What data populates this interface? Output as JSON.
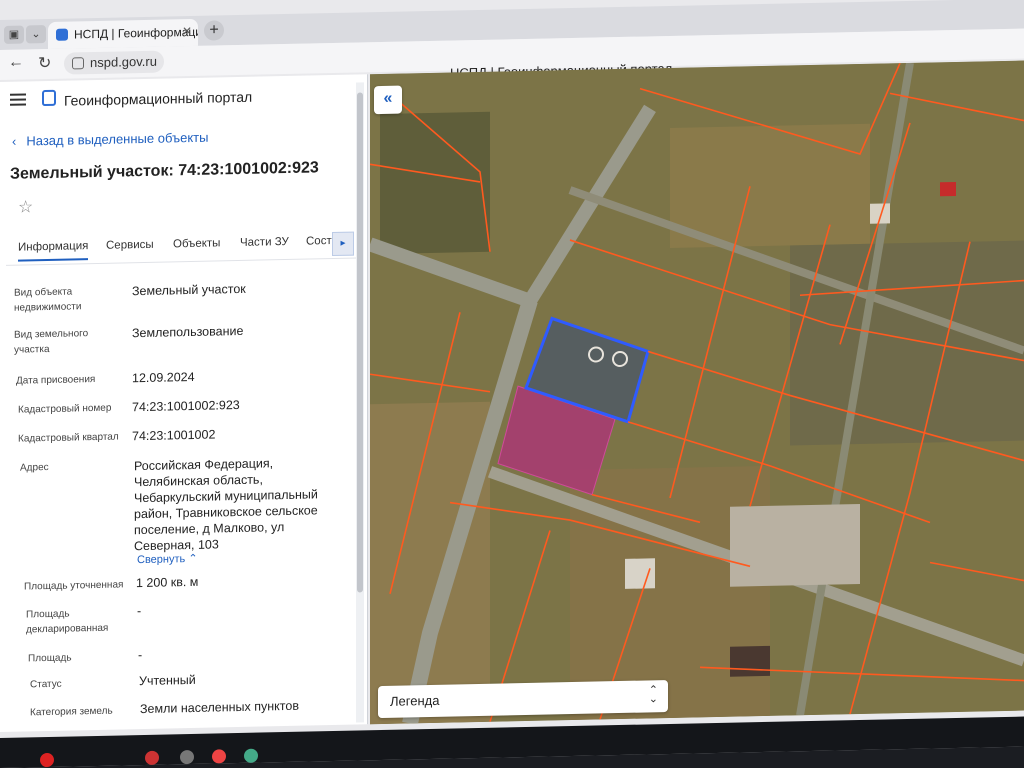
{
  "browser": {
    "tab_title": "НСПД | Геоинформацио",
    "url": "nspd.gov.ru",
    "window_title": "НСПД | Геоинформационный портал",
    "icons": [
      "window-menu-icon",
      "chevron-down-icon",
      "favicon-icon",
      "close-icon",
      "plus-icon",
      "back-arrow-icon",
      "reload-icon",
      "site-info-icon"
    ]
  },
  "panel": {
    "portal_title": "Геоинформационный портал",
    "back_link": "Назад в выделенные объекты",
    "parcel_title": "Земельный участок: 74:23:1001002:923",
    "tabs": [
      {
        "label": "Информация"
      },
      {
        "label": "Сервисы"
      },
      {
        "label": "Объекты"
      },
      {
        "label": "Части ЗУ"
      },
      {
        "label": "Соста"
      }
    ],
    "properties": [
      {
        "label": "Вид объекта недвижимости",
        "value": "Земельный участок"
      },
      {
        "label": "Вид земельного участка",
        "value": "Землепользование"
      },
      {
        "label": "Дата присвоения",
        "value": "12.09.2024"
      },
      {
        "label": "Кадастровый номер",
        "value": "74:23:1001002:923"
      },
      {
        "label": "Кадастровый квартал",
        "value": "74:23:1001002"
      },
      {
        "label": "Адрес",
        "value": "Российская Федерация, Челябинская область, Чебаркульский муниципальный район, Травниковское сельское поселение, д Малково, ул Северная, 103"
      },
      {
        "label": "Площадь уточненная",
        "value": "1 200 кв. м"
      },
      {
        "label": "Площадь декларированная",
        "value": "-"
      },
      {
        "label": "Площадь",
        "value": "-"
      },
      {
        "label": "Статус",
        "value": "Учтенный"
      },
      {
        "label": "Категория земель",
        "value": "Земли населенных пунктов"
      }
    ],
    "collapse_link": "Свернуть"
  },
  "map": {
    "collapse_button": "«",
    "legend_label": "Легенда",
    "colors": {
      "parcel_border": "#ff5a1f",
      "selected_border": "#2f5bff",
      "adjacent_fill": "#b0307a",
      "terrain": "#7c7447",
      "road": "#9a9a8c"
    }
  }
}
